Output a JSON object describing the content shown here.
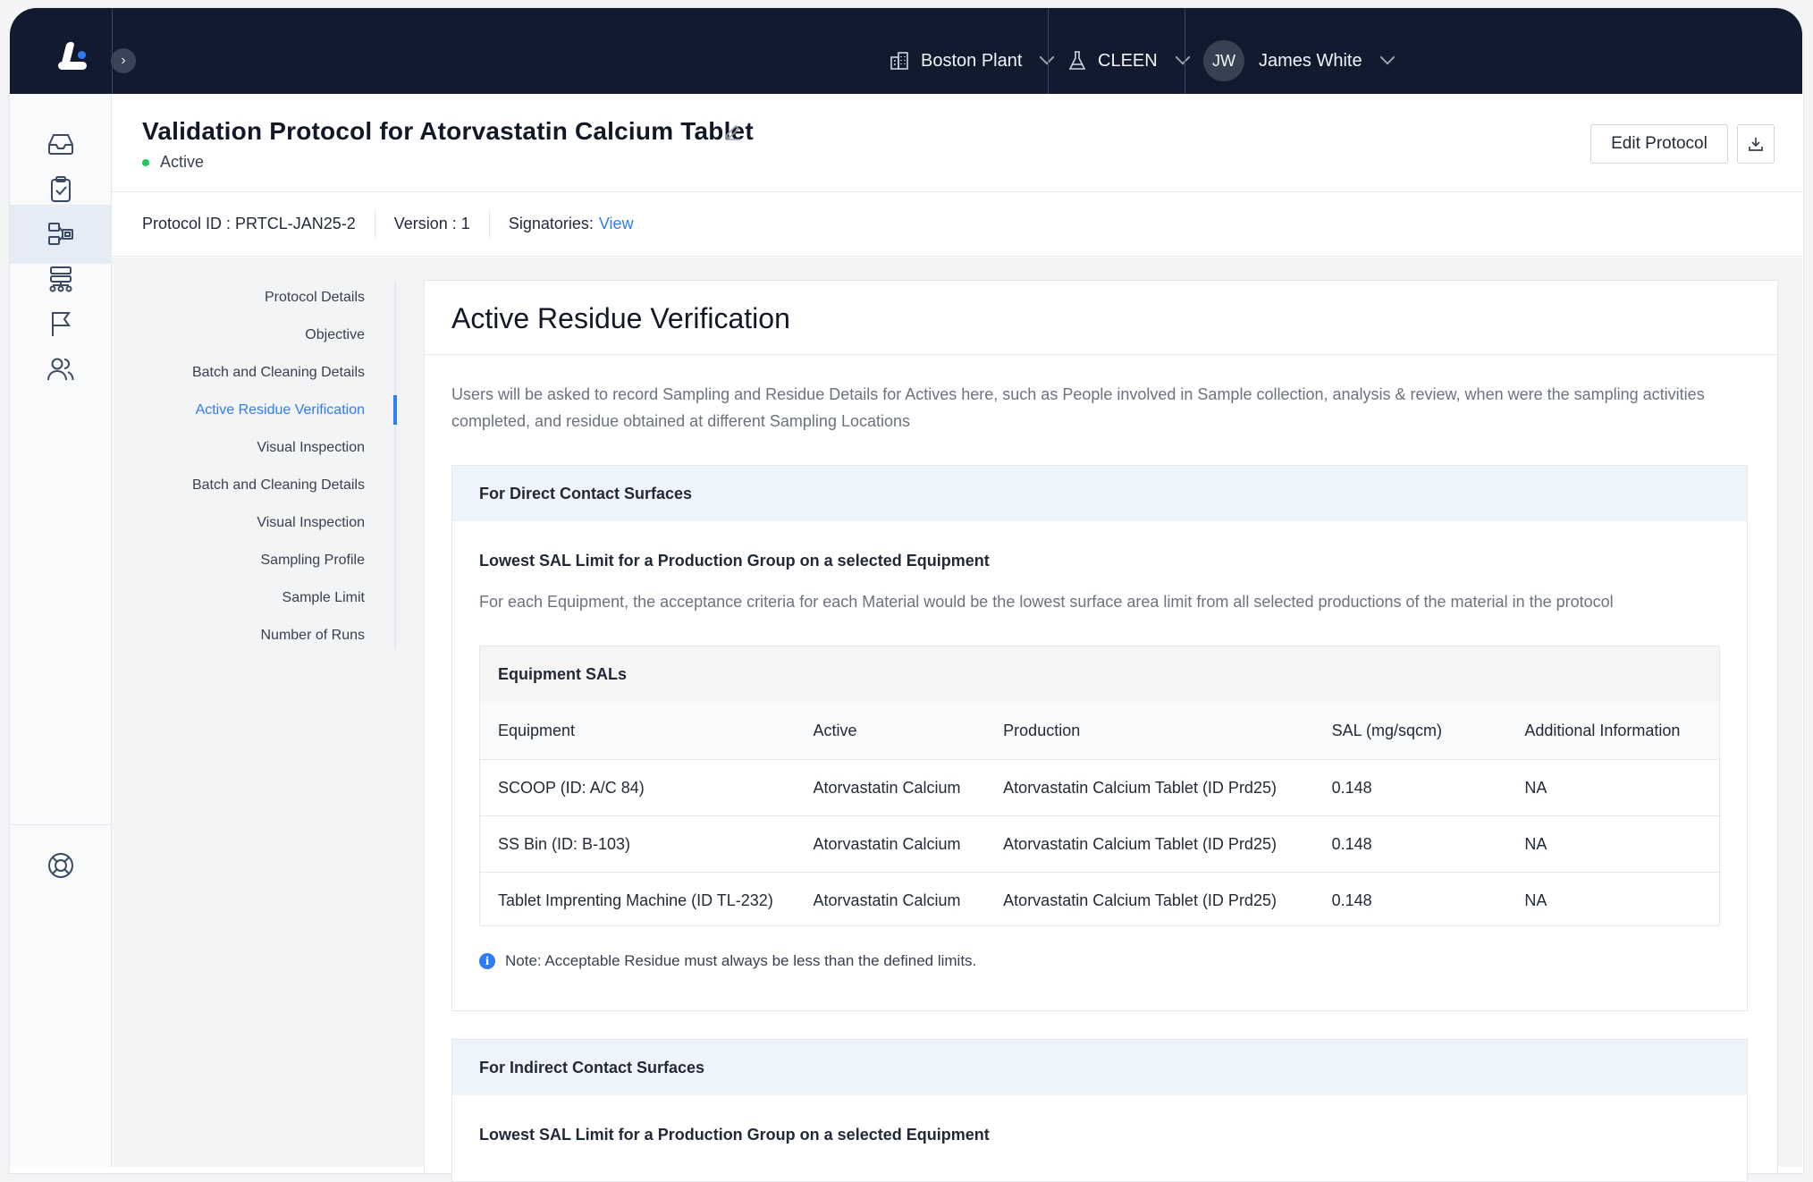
{
  "topbar": {
    "plant": "Boston Plant",
    "module": "CLEEN",
    "user": {
      "initials": "JW",
      "name": "James White"
    }
  },
  "rail": {
    "icons": [
      "inbox-icon",
      "clipboard-check-icon",
      "protocol-icon",
      "hierarchy-icon",
      "flag-icon",
      "users-icon",
      "support-icon"
    ],
    "active": "protocol-icon"
  },
  "header": {
    "title": "Validation Protocol for Atorvastatin Calcium Tablet",
    "status": "Active",
    "edit_button": "Edit Protocol"
  },
  "meta": {
    "protocol_id": "Protocol ID : PRTCL-JAN25-2",
    "version": "Version : 1",
    "signatories_label": "Signatories:",
    "signatories_link": "View"
  },
  "stepnav": {
    "items": [
      "Protocol Details",
      "Objective",
      "Batch and Cleaning Details",
      "Active Residue Verification",
      "Visual Inspection",
      "Batch and Cleaning Details",
      "Visual Inspection",
      "Sampling Profile",
      "Sample Limit",
      "Number of Runs"
    ],
    "active_index": 3
  },
  "main": {
    "title": "Active Residue Verification",
    "description": "Users will be asked to record Sampling and Residue Details for Actives here, such as People involved in Sample collection, analysis & review, when were the sampling activities completed, and residue obtained at different Sampling Locations",
    "direct": {
      "heading": "For Direct Contact Surfaces",
      "subtitle": "Lowest SAL Limit for a Production Group on a selected Equipment",
      "subdesc": "For each Equipment, the acceptance criteria for each Material would be the lowest surface area limit from all selected productions of the material in the protocol",
      "table": {
        "caption": "Equipment SALs",
        "columns": [
          "Equipment",
          "Active",
          "Production",
          "SAL (mg/sqcm)",
          "Additional Information"
        ],
        "rows": [
          [
            "SCOOP (ID: A/C 84)",
            "Atorvastatin Calcium",
            "Atorvastatin Calcium Tablet (ID Prd25)",
            "0.148",
            "NA"
          ],
          [
            "SS Bin (ID: B-103)",
            "Atorvastatin Calcium",
            "Atorvastatin Calcium Tablet (ID Prd25)",
            "0.148",
            "NA"
          ],
          [
            "Tablet Imprenting Machine (ID TL-232)",
            "Atorvastatin Calcium",
            "Atorvastatin Calcium Tablet (ID Prd25)",
            "0.148",
            "NA"
          ]
        ]
      },
      "note": "Note: Acceptable Residue must always be less than the defined limits."
    },
    "indirect": {
      "heading": "For Indirect Contact Surfaces",
      "subtitle": "Lowest SAL Limit for a Production Group on a selected Equipment"
    }
  },
  "colors": {
    "accent": "#2f7cf6",
    "topbar": "#111a2e",
    "status_active": "#22c55e",
    "section_head": "#eef4fc"
  }
}
